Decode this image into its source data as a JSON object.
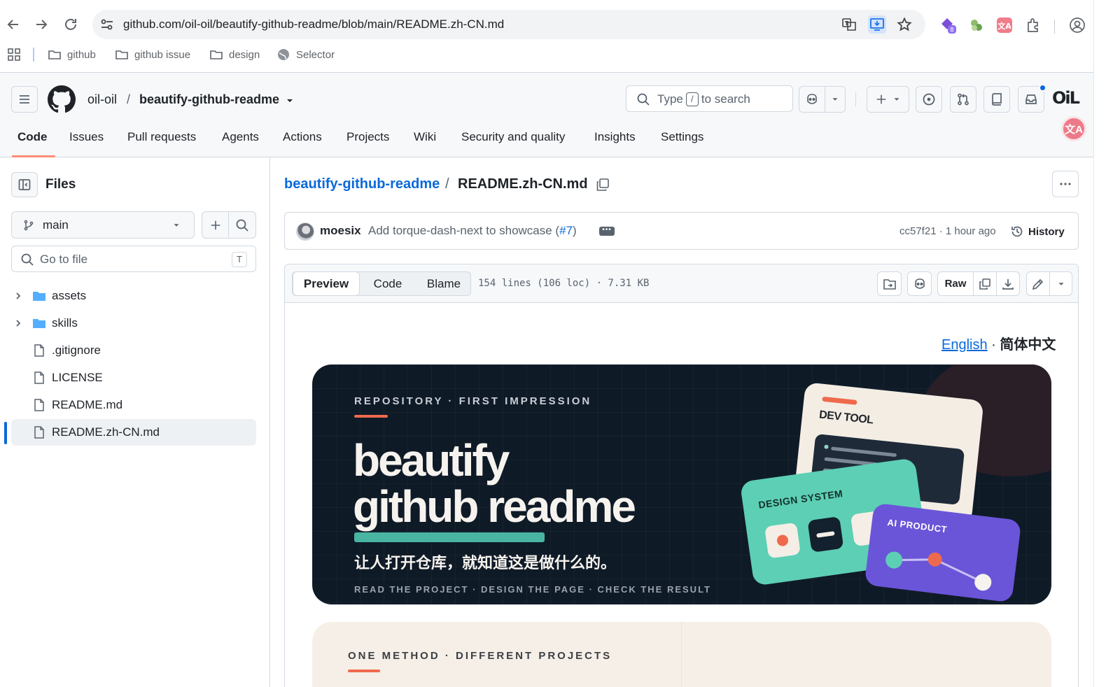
{
  "browser": {
    "url": "github.com/oil-oil/beautify-github-readme/blob/main/README.zh-CN.md",
    "bookmarks": [
      {
        "label": "github",
        "icon": "folder-icon"
      },
      {
        "label": "github issue",
        "icon": "folder-icon"
      },
      {
        "label": "design",
        "icon": "folder-icon"
      },
      {
        "label": "Selector",
        "icon": "globe-icon"
      }
    ]
  },
  "header": {
    "owner": "oil-oil",
    "separator": "/",
    "repo": "beautify-github-readme",
    "search_prefix": "Type",
    "search_key": "/",
    "search_suffix": "to search",
    "avatar_text": "OiL",
    "translate_glyph": "文A"
  },
  "repo_tabs": [
    "Code",
    "Issues",
    "Pull requests",
    "Agents",
    "Actions",
    "Projects",
    "Wiki",
    "Security and quality",
    "Insights",
    "Settings"
  ],
  "sidebar": {
    "title": "Files",
    "branch": "main",
    "goto_placeholder": "Go to file",
    "goto_key": "T",
    "tree": [
      {
        "name": "assets",
        "type": "folder"
      },
      {
        "name": "skills",
        "type": "folder"
      },
      {
        "name": ".gitignore",
        "type": "file"
      },
      {
        "name": "LICENSE",
        "type": "file"
      },
      {
        "name": "README.md",
        "type": "file"
      },
      {
        "name": "README.zh-CN.md",
        "type": "file",
        "active": true
      }
    ]
  },
  "breadcrumb": {
    "repo": "beautify-github-readme",
    "separator": "/",
    "file": "README.zh-CN.md"
  },
  "commit": {
    "author": "moesix",
    "message": "Add torque-dash-next to showcase (",
    "pr": "#7",
    "message_end": ")",
    "more": "•••",
    "meta": "cc57f21 · 1 hour ago",
    "history_label": "History"
  },
  "file_toolbar": {
    "tabs": [
      "Preview",
      "Code",
      "Blame"
    ],
    "stats": "154 lines (106 loc) · 7.31 KB",
    "raw_label": "Raw"
  },
  "readme": {
    "lang_en": "English",
    "lang_sep": " · ",
    "lang_zh": "简体中文",
    "banner": {
      "kicker": "REPOSITORY · FIRST IMPRESSION",
      "title_line1": "beautify",
      "title_line2": "github readme",
      "subtitle": "让人打开仓库，就知道这是做什么的。",
      "footer": "READ THE PROJECT · DESIGN THE PAGE · CHECK THE RESULT",
      "card_dev": "DEV TOOL",
      "card_ds": "DESIGN SYSTEM",
      "card_ai": "AI PRODUCT"
    },
    "banner2": {
      "kicker": "ONE METHOD · DIFFERENT PROJECTS"
    }
  },
  "colors": {
    "link": "#0969da",
    "accent_tab": "#fd8c73",
    "banner_bg": "#0f1a27",
    "coral": "#ef6a4c",
    "teal": "#49b4a2",
    "purple": "#6a55d8"
  }
}
